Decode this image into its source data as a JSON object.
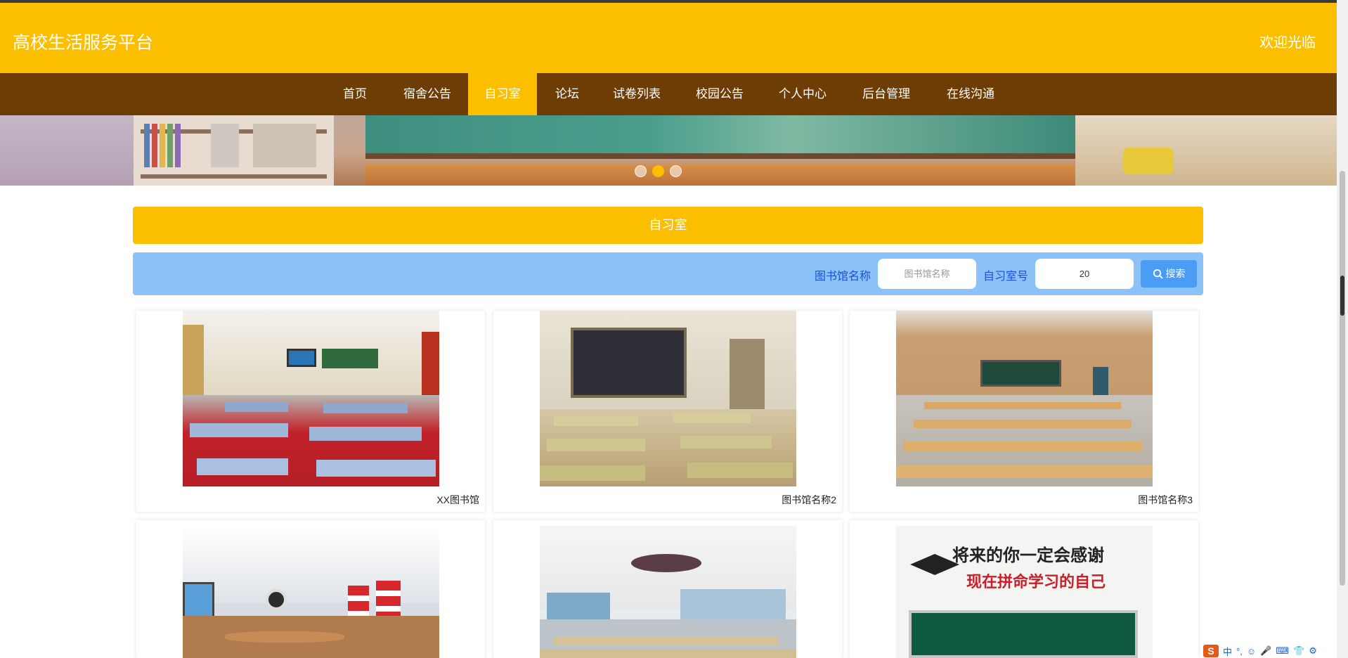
{
  "header": {
    "site_title": "高校生活服务平台",
    "welcome": "欢迎光临"
  },
  "nav": {
    "items": [
      {
        "label": "首页"
      },
      {
        "label": "宿舍公告"
      },
      {
        "label": "自习室",
        "active": true
      },
      {
        "label": "论坛"
      },
      {
        "label": "试卷列表"
      },
      {
        "label": "校园公告"
      },
      {
        "label": "个人中心"
      },
      {
        "label": "后台管理"
      },
      {
        "label": "在线沟通"
      }
    ]
  },
  "carousel": {
    "slide_count": 3,
    "active_index": 1
  },
  "section": {
    "title": "自习室"
  },
  "search": {
    "library_label": "图书馆名称",
    "library_placeholder": "图书馆名称",
    "library_value": "",
    "room_label": "自习室号",
    "room_value": "20",
    "button_label": "搜索"
  },
  "cards": [
    {
      "name": "XX图书馆"
    },
    {
      "name": "图书馆名称2"
    },
    {
      "name": "图书馆名称3"
    },
    {
      "name": ""
    },
    {
      "name": ""
    },
    {
      "name": ""
    }
  ],
  "poster": {
    "line1": "将来的你一定会感谢",
    "line2": "现在拼命学习的自己"
  },
  "ime": {
    "logo": "S",
    "mode": "中"
  },
  "colors": {
    "brand": "#fcbf00",
    "nav_bg": "#6d3d05",
    "search_bg": "#8bc3f8",
    "search_button": "#4a9cf5"
  }
}
